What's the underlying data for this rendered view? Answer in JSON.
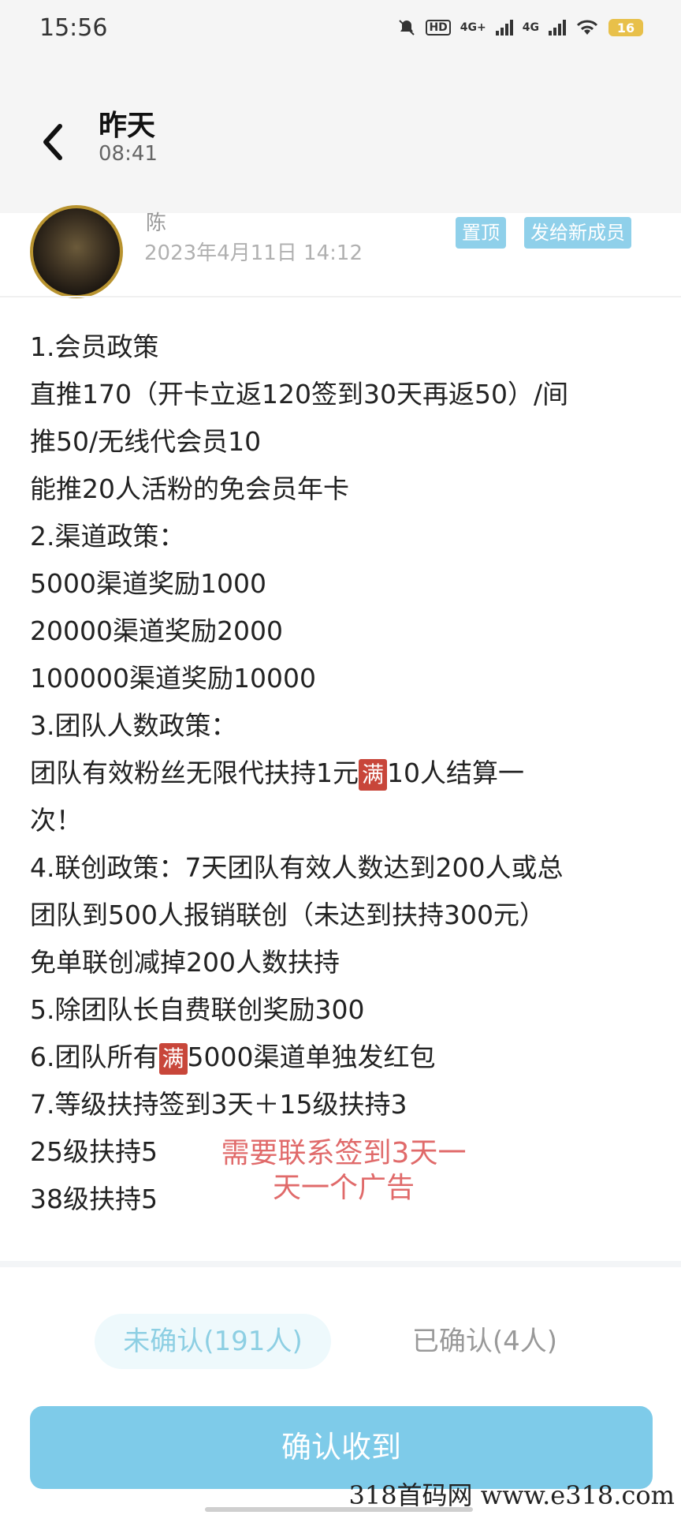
{
  "status_bar": {
    "time": "15:56",
    "hd_label": "HD",
    "signal1": "4G+",
    "signal2": "4G",
    "battery": "16"
  },
  "header": {
    "title": "昨天",
    "time": "08:41"
  },
  "post": {
    "author": "陈",
    "date": "2023年4月11日 14:12",
    "tag_top": "置顶",
    "tag_new": "发给新成员"
  },
  "content": {
    "l1": "1.会员政策",
    "l2": "直推170（开卡立返120签到30天再返50）/间",
    "l3": "推50/无线代会员10",
    "l4": "能推20人活粉的免会员年卡",
    "l5": "2.渠道政策：",
    "l6": "5000渠道奖励1000",
    "l7": "20000渠道奖励2000",
    "l8": "100000渠道奖励10000",
    "l9": "3.团队人数政策：",
    "l10a": "团队有效粉丝无限代扶持1元",
    "l10badge": "满",
    "l10b": "10人结算一",
    "l11": "次！",
    "l12": "4.联创政策：7天团队有效人数达到200人或总",
    "l13": "团队到500人报销联创（未达到扶持300元）",
    "l14": "免单联创减掉200人数扶持",
    "l15": "5.除团队长自费联创奖励300",
    "l16a": "6.团队所有",
    "l16badge": "满",
    "l16b": "5000渠道单独发红包",
    "l17": "7.等级扶持签到3天＋15级扶持3",
    "l18": "25级扶持5",
    "l19": "38级扶持5"
  },
  "red_note": {
    "line1": "需要联系签到3天一",
    "line2": "天一个广告"
  },
  "tabs": {
    "unconfirmed": "未确认(191人)",
    "confirmed": "已确认(4人)"
  },
  "confirm_button": "确认收到",
  "watermark": "318首码网  www.e318.com",
  "colors": {
    "accent": "#7ecbe9",
    "tag": "#8fd0ea",
    "badge": "#c8463a",
    "note": "#e06a6a"
  }
}
